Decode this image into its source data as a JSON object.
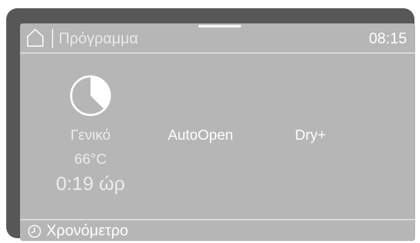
{
  "header": {
    "home_icon": "home-icon",
    "title": "Πρόγραμμα",
    "time": "08:15"
  },
  "program": {
    "icon": "pie-chart-icon",
    "name": "Γενικό",
    "temperature": "66°C",
    "duration": "0:19 ώρ"
  },
  "options": {
    "auto_open": "AutoOpen",
    "dry_plus": "Dry+"
  },
  "footer": {
    "icon": "clock-icon",
    "label": "Χρονόμετρο"
  },
  "colors": {
    "bezel": "#575757",
    "screen": "#b6b6b6",
    "text": "#ffffff"
  }
}
